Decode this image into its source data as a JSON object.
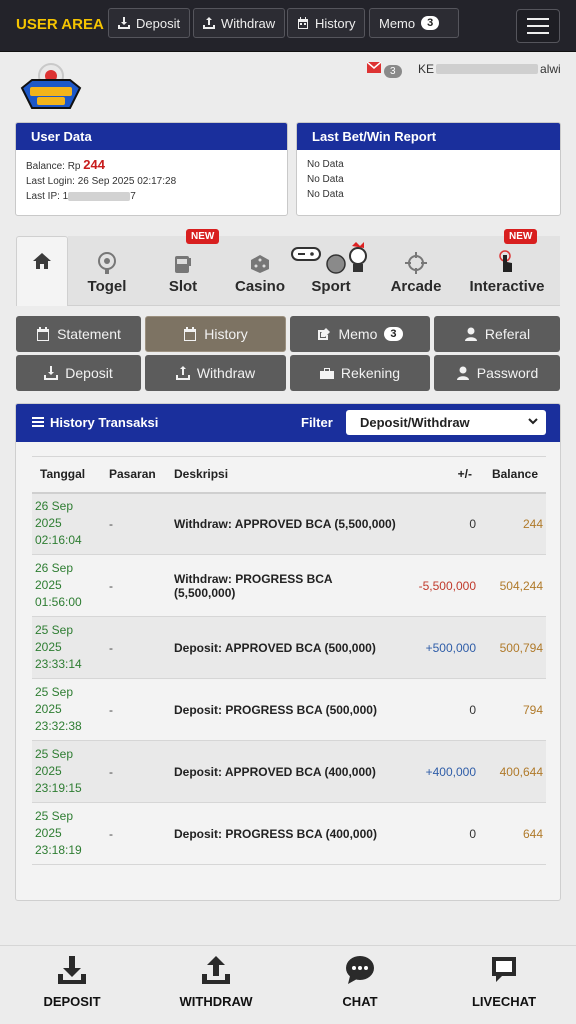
{
  "topbar": {
    "brand": "USER AREA",
    "buttons": [
      {
        "label": "Deposit",
        "icon": "deposit-icon"
      },
      {
        "label": "Withdraw",
        "icon": "withdraw-icon"
      },
      {
        "label": "History",
        "icon": "calendar-icon"
      },
      {
        "label": "Memo",
        "badge": "3"
      }
    ],
    "menu_icon": "hamburger-icon"
  },
  "header": {
    "mail_badge": "3",
    "username_start": "KE",
    "username_end": "alwi"
  },
  "user_data": {
    "title": "User Data",
    "balance_label": "Balance: Rp",
    "balance_value": "244",
    "last_login": "Last Login: 26 Sep 2025 02:17:28",
    "last_ip_label": "Last IP: 1",
    "last_ip_end": "7"
  },
  "last_bet": {
    "title": "Last Bet/Win Report",
    "rows": [
      "No Data",
      "No Data",
      "No Data"
    ]
  },
  "categories": [
    {
      "label": "Togel",
      "icon": "togel-icon"
    },
    {
      "label": "Slot",
      "icon": "slot-icon",
      "badge": "NEW"
    },
    {
      "label": "Casino",
      "icon": "dice-icon"
    },
    {
      "label": "Sport",
      "icon": "sport-icon"
    },
    {
      "label": "Arcade",
      "icon": "crosshair-icon"
    },
    {
      "label": "Interactive",
      "icon": "touch-icon",
      "badge": "NEW"
    }
  ],
  "menu_grid": [
    {
      "label": "Statement"
    },
    {
      "label": "History"
    },
    {
      "label": "Memo",
      "badge": "3"
    },
    {
      "label": "Referal"
    },
    {
      "label": "Deposit"
    },
    {
      "label": "Withdraw"
    },
    {
      "label": "Rekening"
    },
    {
      "label": "Password"
    }
  ],
  "history": {
    "title": "History Transaksi",
    "filter_label": "Filter",
    "filter_value": "Deposit/Withdraw",
    "columns": [
      "Tanggal",
      "Pasaran",
      "Deskripsi",
      "+/-",
      "Balance"
    ],
    "rows": [
      {
        "d1": "26 Sep",
        "d2": "2025",
        "d3": "02:16:04",
        "pasaran": "-",
        "desc": "Withdraw: APPROVED BCA (5,500,000)",
        "amount": "0",
        "balance": "244",
        "sign": "zero"
      },
      {
        "d1": "26 Sep",
        "d2": "2025",
        "d3": "01:56:00",
        "pasaran": "-",
        "desc": "Withdraw: PROGRESS BCA (5,500,000)",
        "amount": "-5,500,000",
        "balance": "504,244",
        "sign": "neg"
      },
      {
        "d1": "25 Sep",
        "d2": "2025",
        "d3": "23:33:14",
        "pasaran": "-",
        "desc": "Deposit: APPROVED BCA (500,000)",
        "amount": "+500,000",
        "balance": "500,794",
        "sign": "pos"
      },
      {
        "d1": "25 Sep",
        "d2": "2025",
        "d3": "23:32:38",
        "pasaran": "-",
        "desc": "Deposit: PROGRESS BCA (500,000)",
        "amount": "0",
        "balance": "794",
        "sign": "zero"
      },
      {
        "d1": "25 Sep",
        "d2": "2025",
        "d3": "23:19:15",
        "pasaran": "-",
        "desc": "Deposit: APPROVED BCA (400,000)",
        "amount": "+400,000",
        "balance": "400,644",
        "sign": "pos"
      },
      {
        "d1": "25 Sep",
        "d2": "2025",
        "d3": "23:18:19",
        "pasaran": "-",
        "desc": "Deposit: PROGRESS BCA (400,000)",
        "amount": "0",
        "balance": "644",
        "sign": "zero"
      }
    ]
  },
  "bottom_nav": [
    {
      "label": "DEPOSIT",
      "icon": "download-icon"
    },
    {
      "label": "WITHDRAW",
      "icon": "upload-icon"
    },
    {
      "label": "CHAT",
      "icon": "chat-bubble-icon"
    },
    {
      "label": "LIVECHAT",
      "icon": "livechat-icon"
    }
  ],
  "colors": {
    "header_blue": "#1a2f9c",
    "brand_yellow": "#f5c400",
    "topbar_bg": "#23232a",
    "date_green": "#2e7d32",
    "balance_brown": "#b07a2a",
    "negative_red": "#c0392b",
    "positive_blue": "#2f5da8"
  }
}
